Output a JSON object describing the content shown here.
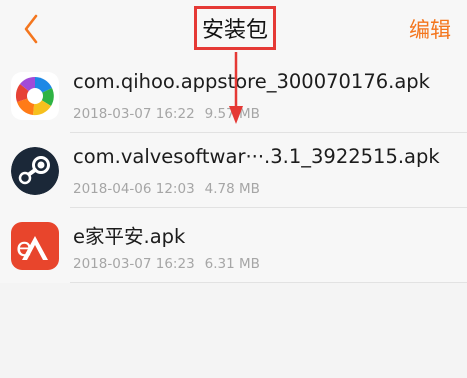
{
  "header": {
    "title": "安装包",
    "edit_label": "编辑",
    "accent_color": "#f4761e",
    "highlight_color": "#e53935"
  },
  "files": [
    {
      "name": "com.qihoo.appstore_300070176.apk",
      "date": "2018-03-07 16:22",
      "size": "9.57 MB",
      "icon": "360-appstore-icon"
    },
    {
      "name": "com.valvesoftwar···.3.1_3922515.apk",
      "date": "2018-04-06 12:03",
      "size": "4.78 MB",
      "icon": "steam-icon"
    },
    {
      "name": "e家平安.apk",
      "date": "2018-03-07 16:23",
      "size": "6.31 MB",
      "icon": "e-jia-ping-an-icon"
    }
  ]
}
